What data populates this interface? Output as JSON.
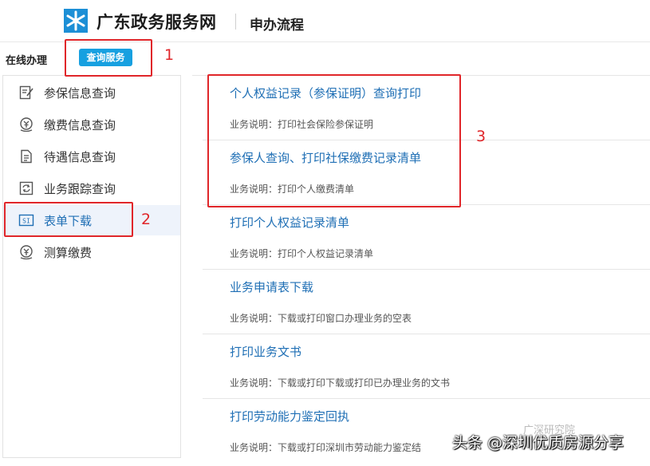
{
  "header": {
    "site_title": "广东政务服务网",
    "section_title": "申办流程"
  },
  "subbar": {
    "online_label": "在线办理",
    "query_button": "查询服务"
  },
  "sidebar": {
    "items": [
      {
        "label": "参保信息查询",
        "icon": "edit-document-icon"
      },
      {
        "label": "缴费信息查询",
        "icon": "payment-icon"
      },
      {
        "label": "待遇信息查询",
        "icon": "document-icon"
      },
      {
        "label": "业务跟踪查询",
        "icon": "refresh-icon"
      },
      {
        "label": "表单下载",
        "icon": "form-download-icon",
        "active": true
      },
      {
        "label": "测算缴费",
        "icon": "calculate-icon"
      }
    ]
  },
  "cards": [
    {
      "title": "个人权益记录（参保证明）查询打印",
      "desc": "业务说明：打印社会保险参保证明"
    },
    {
      "title": "参保人查询、打印社保缴费记录清单",
      "desc": "业务说明：打印个人缴费清单"
    },
    {
      "title": "打印个人权益记录清单",
      "desc": "业务说明：打印个人权益记录清单"
    },
    {
      "title": "业务申请表下载",
      "desc": "业务说明：下载或打印窗口办理业务的空表"
    },
    {
      "title": "打印业务文书",
      "desc": "业务说明：下载或打印下载或打印已办理业务的文书"
    },
    {
      "title": "打印劳动能力鉴定回执",
      "desc": "业务说明：下载或打印深圳市劳动能力鉴定结"
    }
  ],
  "annotations": [
    "1",
    "2",
    "3"
  ],
  "watermark": {
    "main": "头条 @深圳优质房源分享",
    "top": "广深研究院"
  },
  "colors": {
    "accent": "#17a0e0",
    "link": "#1f6fb5",
    "annotation": "#e0262a",
    "active_bg": "#eef3fb"
  }
}
